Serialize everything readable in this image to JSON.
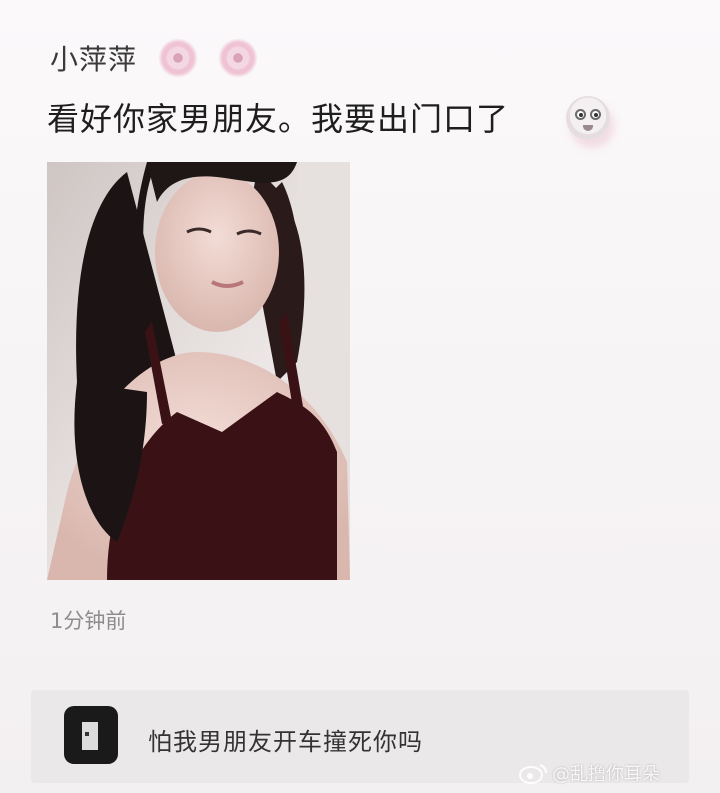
{
  "post": {
    "username": "小萍萍",
    "text": "看好你家男朋友。我要出门口了",
    "timestamp": "1分钟前",
    "emojis": [
      "flower-emoji",
      "flower-emoji",
      "shocked-face-emoji"
    ]
  },
  "comment": {
    "text": "怕我男朋友开车撞死你吗",
    "avatar_icon": "door-avatar-icon"
  },
  "watermark": {
    "text": "@乱撸你耳朵",
    "icon": "weibo-logo-icon"
  }
}
